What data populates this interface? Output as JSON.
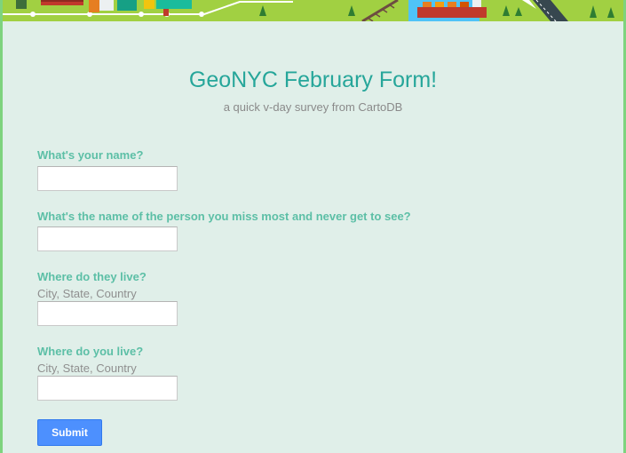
{
  "header": {
    "illustration": "city-map-illustration"
  },
  "form": {
    "title": "GeoNYC February Form!",
    "subtitle": "a quick v-day survey from CartoDB",
    "questions": [
      {
        "label": "What's your name?",
        "help": "",
        "value": ""
      },
      {
        "label": "What's the name of the person you miss most and never get to see?",
        "help": "",
        "value": ""
      },
      {
        "label": "Where do they live?",
        "help": "City, State, Country",
        "value": ""
      },
      {
        "label": "Where do you live?",
        "help": "City, State, Country",
        "value": ""
      }
    ],
    "submit_label": "Submit"
  },
  "colors": {
    "background": "#e0efe9",
    "title": "#26a69a",
    "label": "#5cbfa6",
    "button": "#4d90fe",
    "banner": "#9ccc3c"
  }
}
